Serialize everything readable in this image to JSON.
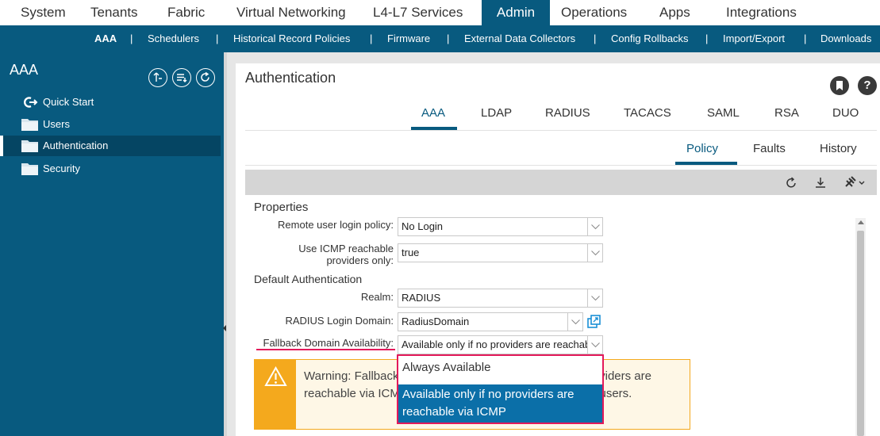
{
  "top_nav": [
    {
      "label": "System",
      "active": false
    },
    {
      "label": "Tenants",
      "active": false
    },
    {
      "label": "Fabric",
      "active": false
    },
    {
      "label": "Virtual Networking",
      "active": false
    },
    {
      "label": "L4-L7 Services",
      "active": false
    },
    {
      "label": "Admin",
      "active": true
    },
    {
      "label": "Operations",
      "active": false
    },
    {
      "label": "Apps",
      "active": false
    },
    {
      "label": "Integrations",
      "active": false
    }
  ],
  "sub_nav": [
    {
      "label": "AAA",
      "active": true
    },
    {
      "label": "Schedulers"
    },
    {
      "label": "Historical Record Policies"
    },
    {
      "label": "Firmware"
    },
    {
      "label": "External Data Collectors"
    },
    {
      "label": "Config Rollbacks"
    },
    {
      "label": "Import/Export"
    },
    {
      "label": "Downloads"
    }
  ],
  "sub_nav_separator": "|",
  "sidebar": {
    "title": "AAA",
    "items": [
      {
        "label": "Quick Start",
        "icon": "quick-start-icon"
      },
      {
        "label": "Users",
        "icon": "folder-icon"
      },
      {
        "label": "Authentication",
        "icon": "folder-icon",
        "active": true
      },
      {
        "label": "Security",
        "icon": "folder-icon"
      }
    ]
  },
  "page": {
    "title": "Authentication",
    "help_glyph": "?",
    "tabs": [
      {
        "label": "AAA",
        "active": true
      },
      {
        "label": "LDAP"
      },
      {
        "label": "RADIUS"
      },
      {
        "label": "TACACS"
      },
      {
        "label": "SAML"
      },
      {
        "label": "RSA"
      },
      {
        "label": "DUO"
      }
    ],
    "subtabs": [
      {
        "label": "Policy",
        "active": true
      },
      {
        "label": "Faults"
      },
      {
        "label": "History"
      }
    ]
  },
  "properties": {
    "heading": "Properties",
    "remote_login_label": "Remote user login policy:",
    "remote_login_value": "No Login",
    "icmp_label_line1": "Use ICMP reachable",
    "icmp_label_line2": "providers only:",
    "icmp_value": "true",
    "default_auth_heading": "Default Authentication",
    "realm_label": "Realm:",
    "realm_value": "RADIUS",
    "radius_domain_label": "RADIUS Login Domain:",
    "radius_domain_value": "RadiusDomain",
    "fallback_label": "Fallback Domain Availability:",
    "fallback_value": "Available only if no providers are reachable via ICMP"
  },
  "warning": {
    "text": "Warning: Fallback domain will be available only if no providers are reachable via ICMP. You will not be able to authenticate users."
  },
  "dropdown": {
    "options": [
      {
        "label": "Always Available",
        "selected": false
      },
      {
        "label": "Available only if no providers are reachable via ICMP",
        "selected": true
      }
    ]
  },
  "colors": {
    "nav_blue": "#085a7f",
    "highlight_pink": "#e3195a",
    "warning_amber": "#f4a91d",
    "selection_blue": "#0b6fa8"
  }
}
